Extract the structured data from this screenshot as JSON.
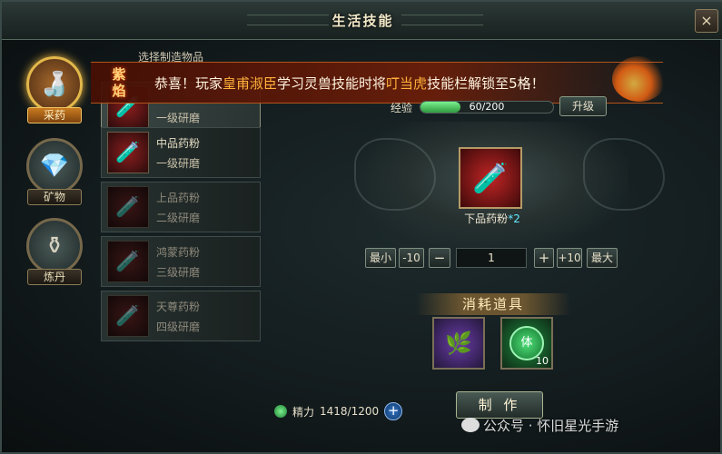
{
  "window": {
    "title": "生活技能",
    "close_icon": "×"
  },
  "tabs": [
    {
      "label": "采药",
      "icon": "herb-icon",
      "glyph": "🍶",
      "active": true
    },
    {
      "label": "矿物",
      "icon": "crystal-icon",
      "glyph": "💎",
      "active": false
    },
    {
      "label": "炼丹",
      "icon": "furnace-icon",
      "glyph": "⚱",
      "active": false
    }
  ],
  "list": {
    "title": "选择制造物品",
    "items": [
      {
        "name": "",
        "grade": "一级研磨",
        "selected": true,
        "locked": false,
        "glyph": "🧪"
      },
      {
        "name": "中品药粉",
        "grade": "一级研磨",
        "selected": false,
        "locked": false,
        "glyph": "🧪"
      },
      {
        "name": "上品药粉",
        "grade": "二级研磨",
        "selected": false,
        "locked": true,
        "glyph": "🧪"
      },
      {
        "name": "鸿蒙药粉",
        "grade": "三级研磨",
        "selected": false,
        "locked": true,
        "glyph": "🧪"
      },
      {
        "name": "天尊药粉",
        "grade": "四级研磨",
        "selected": false,
        "locked": true,
        "glyph": "🧪"
      }
    ]
  },
  "banner": {
    "badge_line1": "紫",
    "badge_line2": "焰",
    "text_pre": "恭喜！玩家",
    "player": "皇甫淑臣",
    "text_mid": "学习灵兽技能时将",
    "skill": "叮当虎",
    "text_post": "技能栏解锁至5格！"
  },
  "exp": {
    "label": "经验",
    "current": 60,
    "max": 200,
    "text": "60/200",
    "upgrade_label": "升级"
  },
  "product": {
    "name": "下品药粉",
    "count": "*2",
    "glyph": "🧪"
  },
  "quantity": {
    "min_label": "最小",
    "minus10_label": "-10",
    "minus_label": "−",
    "value": "1",
    "plus_label": "+",
    "plus10_label": "+10",
    "max_label": "最大"
  },
  "consume": {
    "title": "消耗道具",
    "materials": [
      {
        "icon": "herb-bundle-icon",
        "glyph": "🌿",
        "count": ""
      },
      {
        "icon": "stamina-icon",
        "badge": "体",
        "count": "10"
      }
    ]
  },
  "energy": {
    "label": "精力",
    "value": "1418/1200",
    "plus": "+"
  },
  "make_button": "制 作",
  "watermark": "公众号 · 怀旧星光手游",
  "colors": {
    "accent_gold": "#e3b84b",
    "exp_green": "#2e9a3f",
    "banner_red": "#6e1e08"
  }
}
